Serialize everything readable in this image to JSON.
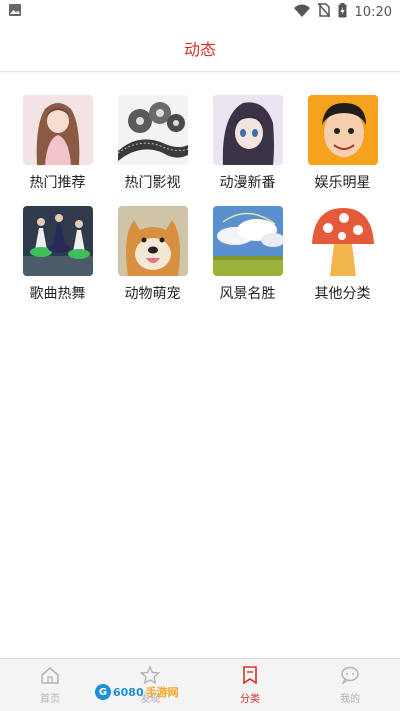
{
  "status": {
    "time": "10:20",
    "icons": [
      "image-icon",
      "wifi-icon",
      "no-sim-icon",
      "battery-charging-icon"
    ]
  },
  "header": {
    "title": "动态"
  },
  "categories": [
    {
      "label": "热门推荐",
      "image": "anime-girl-pink"
    },
    {
      "label": "热门影视",
      "image": "film-reels"
    },
    {
      "label": "动漫新番",
      "image": "anime-girl-dark"
    },
    {
      "label": "娱乐明星",
      "image": "cartoon-man"
    },
    {
      "label": "歌曲热舞",
      "image": "dancers"
    },
    {
      "label": "动物萌宠",
      "image": "shiba-dog"
    },
    {
      "label": "风景名胜",
      "image": "sky-field"
    },
    {
      "label": "其他分类",
      "image": "mushroom"
    }
  ],
  "tabs": [
    {
      "label": "首页",
      "icon": "home-icon"
    },
    {
      "label": "发现",
      "icon": "star-icon"
    },
    {
      "label": "分类",
      "icon": "bookmark-icon"
    },
    {
      "label": "我的",
      "icon": "chat-icon"
    }
  ],
  "watermark": {
    "text_a": "G",
    "text_b": "6080",
    "text_c": "手游网"
  },
  "colors": {
    "accent": "#d4312b",
    "tab_inactive": "#b3b3b3",
    "tabbar_bg": "#f4f4f4"
  }
}
